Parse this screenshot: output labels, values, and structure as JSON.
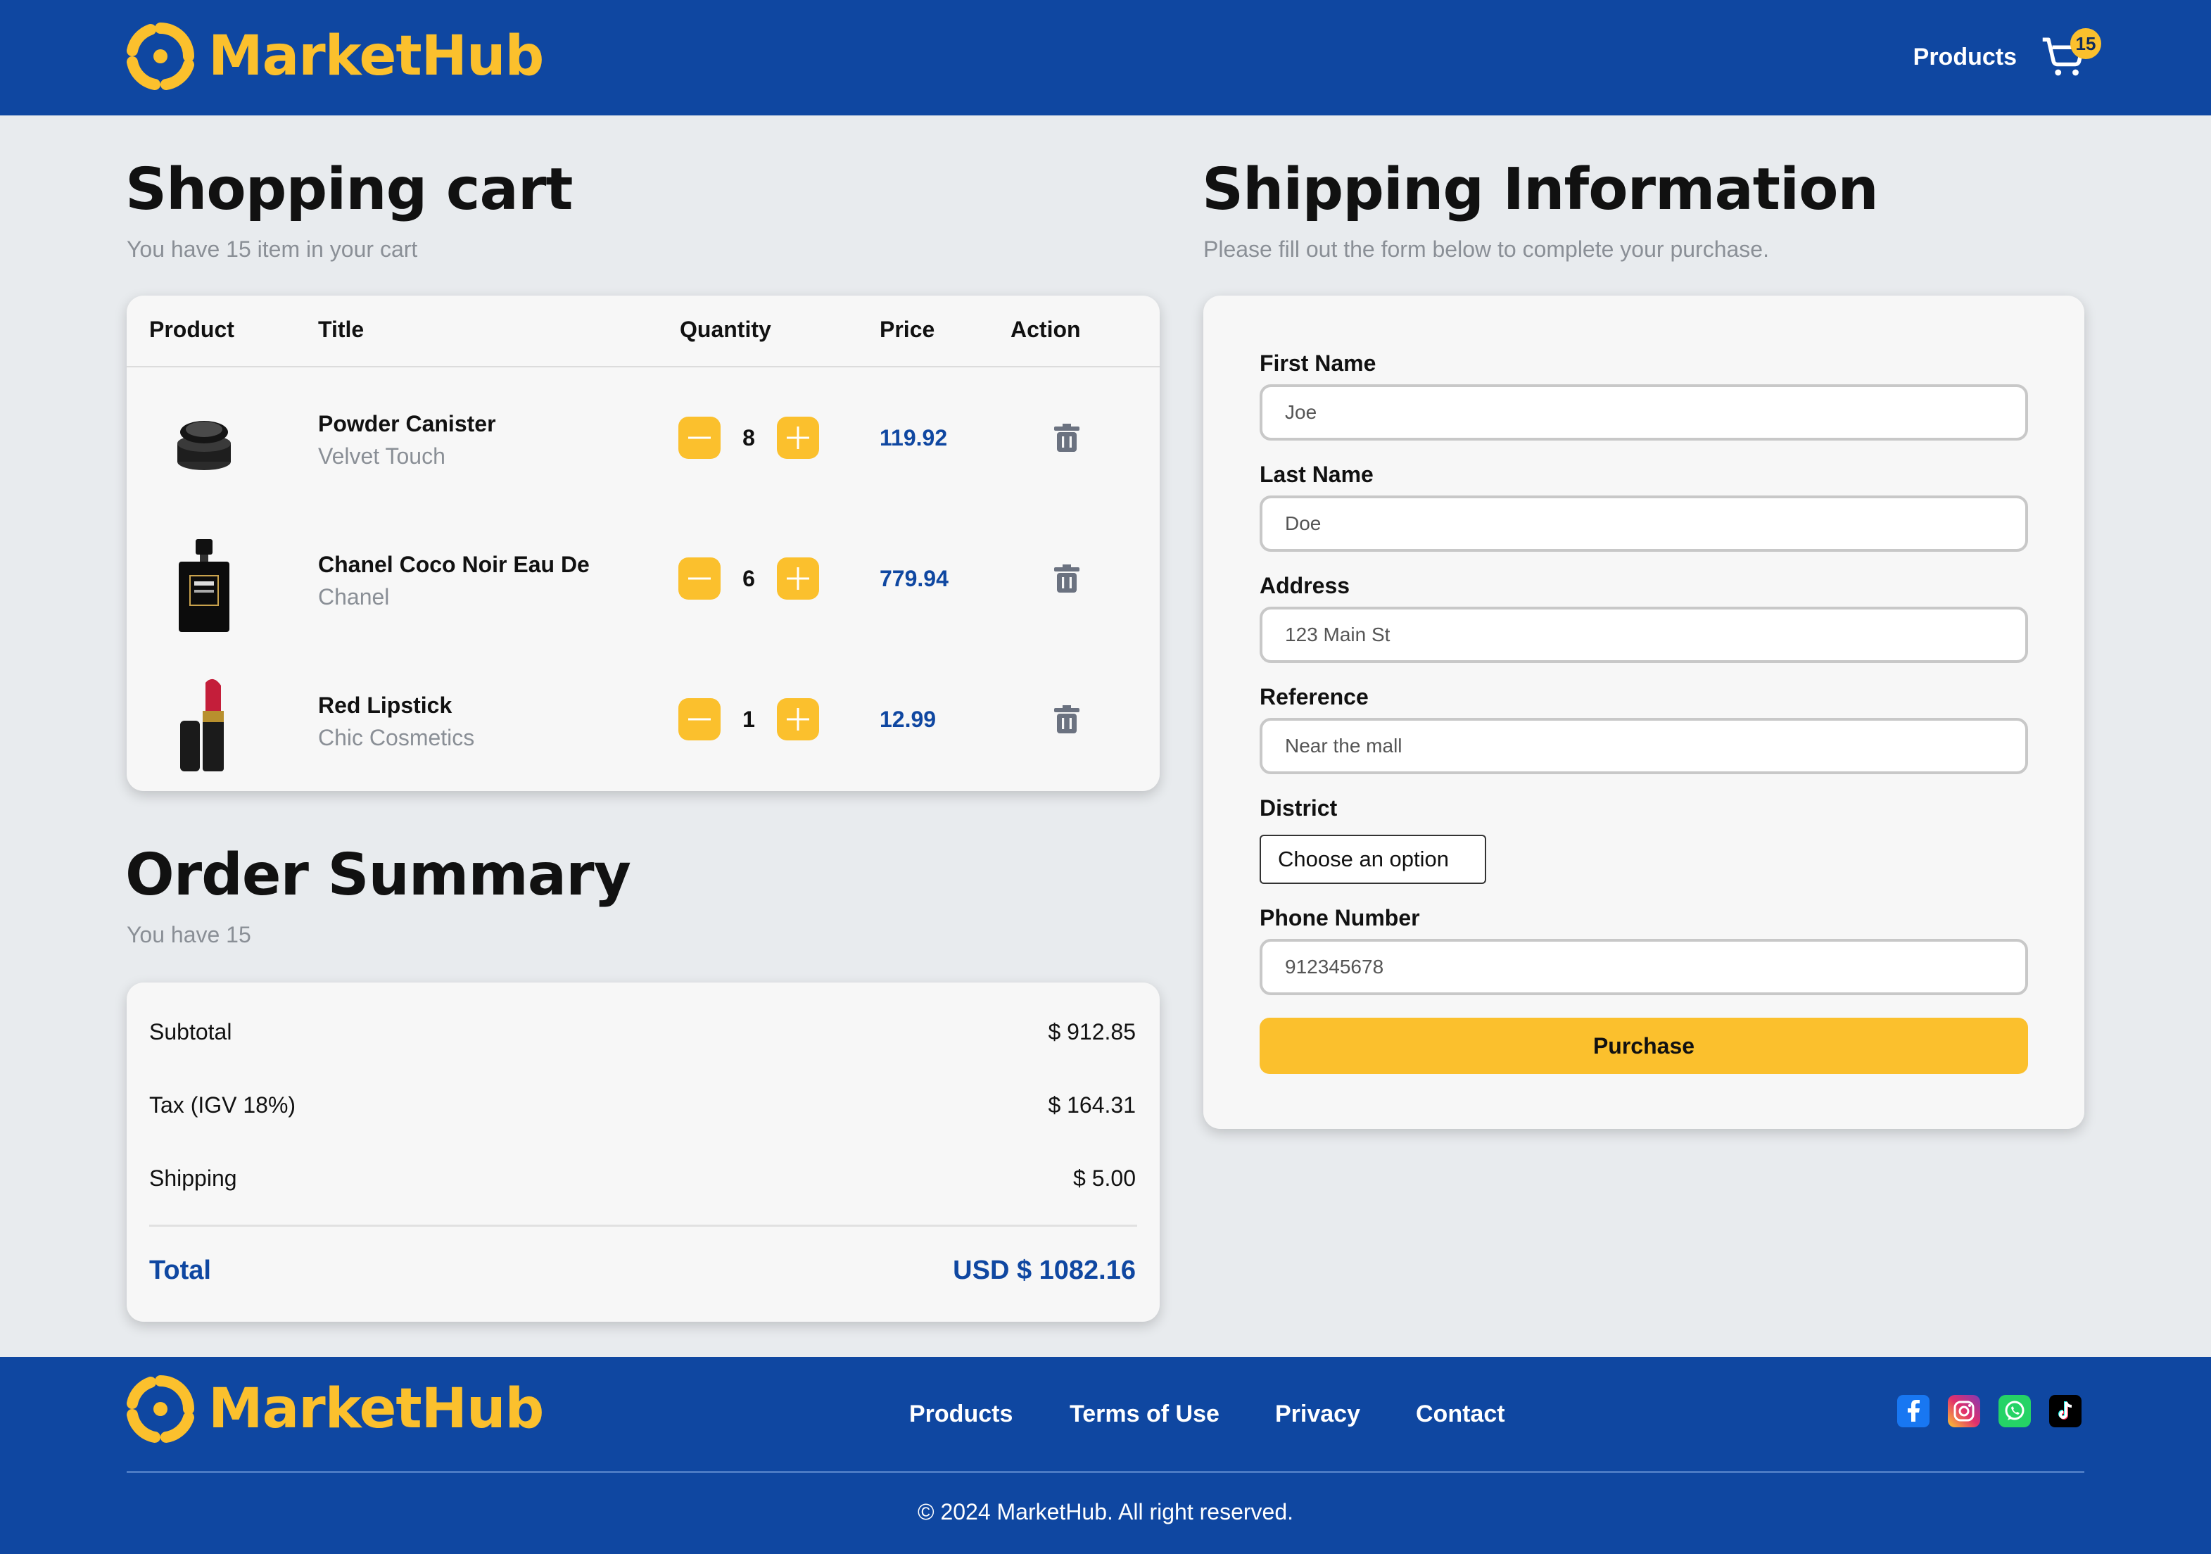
{
  "brand": {
    "name": "MarketHub",
    "primary_color": "#0f47a1",
    "accent_color": "#fbc02d"
  },
  "header": {
    "nav_products": "Products",
    "cart_count": "15",
    "cart_icon": "shopping-cart-icon"
  },
  "cart": {
    "title": "Shopping cart",
    "subtitle": "You have 15 item in your cart",
    "columns": [
      "Product",
      "Title",
      "Quantity",
      "Price",
      "Action"
    ],
    "items": [
      {
        "title": "Powder Canister",
        "brand": "Velvet Touch",
        "quantity": "8",
        "price": "119.92"
      },
      {
        "title": "Chanel Coco Noir Eau De",
        "brand": "Chanel",
        "quantity": "6",
        "price": "779.94"
      },
      {
        "title": "Red Lipstick",
        "brand": "Chic Cosmetics",
        "quantity": "1",
        "price": "12.99"
      }
    ]
  },
  "summary": {
    "title": "Order Summary",
    "subtitle": "You have 15",
    "rows": [
      {
        "label": "Subtotal",
        "value": "$ 912.85"
      },
      {
        "label": "Tax (IGV 18%)",
        "value": "$ 164.31"
      },
      {
        "label": "Shipping",
        "value": "$ 5.00"
      }
    ],
    "total_label": "Total",
    "total_value": "USD $ 1082.16"
  },
  "shipping": {
    "title": "Shipping Information",
    "subtitle": "Please fill out the form below to complete your purchase.",
    "fields": [
      {
        "label": "First Name",
        "value": "Joe"
      },
      {
        "label": "Last Name",
        "value": "Doe"
      },
      {
        "label": "Address",
        "value": "123 Main St"
      },
      {
        "label": "Reference",
        "value": "Near the mall"
      }
    ],
    "district_label": "District",
    "district_value": "Choose an option",
    "phone_label": "Phone Number",
    "phone_value": "912345678",
    "purchase_label": "Purchase"
  },
  "footer": {
    "nav": [
      "Products",
      "Terms of Use",
      "Privacy",
      "Contact"
    ],
    "social": [
      "facebook-icon",
      "instagram-icon",
      "whatsapp-icon",
      "tiktok-icon"
    ],
    "copyright": "© 2024 MarketHub. All right reserved."
  }
}
